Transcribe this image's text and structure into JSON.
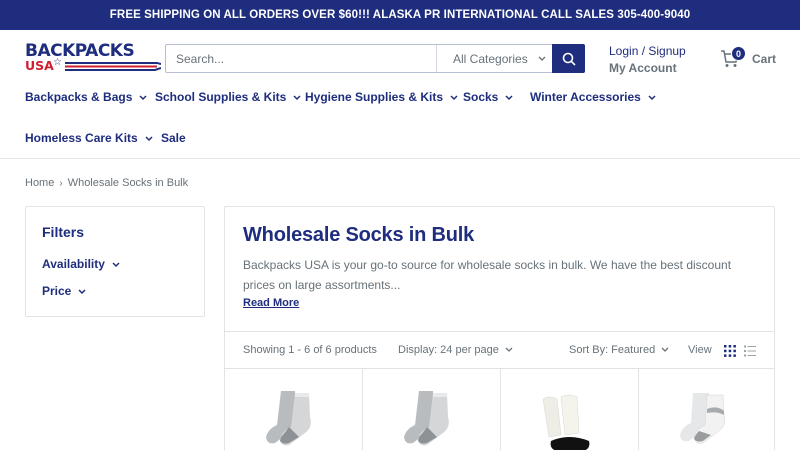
{
  "announcement": "FREE SHIPPING ON ALL ORDERS OVER $60!!! ALASKA PR INTERNATIONAL CALL SALES 305-400-9040",
  "logo": {
    "word": "BACKPACKS",
    "sub": "USA"
  },
  "search": {
    "placeholder": "Search...",
    "category": "All Categories"
  },
  "account": {
    "login": "Login / Signup",
    "my_account": "My Account"
  },
  "cart": {
    "label": "Cart",
    "count": "0"
  },
  "nav": [
    {
      "label": "Backpacks & Bags"
    },
    {
      "label": "School Supplies & Kits"
    },
    {
      "label": "Hygiene Supplies & Kits"
    },
    {
      "label": "Socks"
    },
    {
      "label": "Winter Accessories"
    },
    {
      "label": "Homeless Care Kits"
    },
    {
      "label": "Sale"
    }
  ],
  "breadcrumb": {
    "home": "Home",
    "current": "Wholesale Socks in Bulk"
  },
  "filters": {
    "title": "Filters",
    "availability": "Availability",
    "price": "Price"
  },
  "collection": {
    "title": "Wholesale Socks in Bulk",
    "description": "Backpacks USA is your go-to source for wholesale socks in bulk. We have the best discount prices on large assortments...",
    "read_more": "Read More"
  },
  "toolbar": {
    "showing": "Showing 1 - 6 of 6 products",
    "display": "Display: 24 per page",
    "sort": "Sort By: Featured",
    "view": "View"
  },
  "colors": {
    "primary": "#1e2d7d",
    "muted": "#677279",
    "border": "#e1e3e4",
    "accent_red": "#d0202f"
  },
  "products": [
    {
      "image": "gray-crew-socks"
    },
    {
      "image": "gray-crew-socks"
    },
    {
      "image": "black-white-low-cut-socks"
    },
    {
      "image": "white-gray-quarter-socks"
    }
  ]
}
